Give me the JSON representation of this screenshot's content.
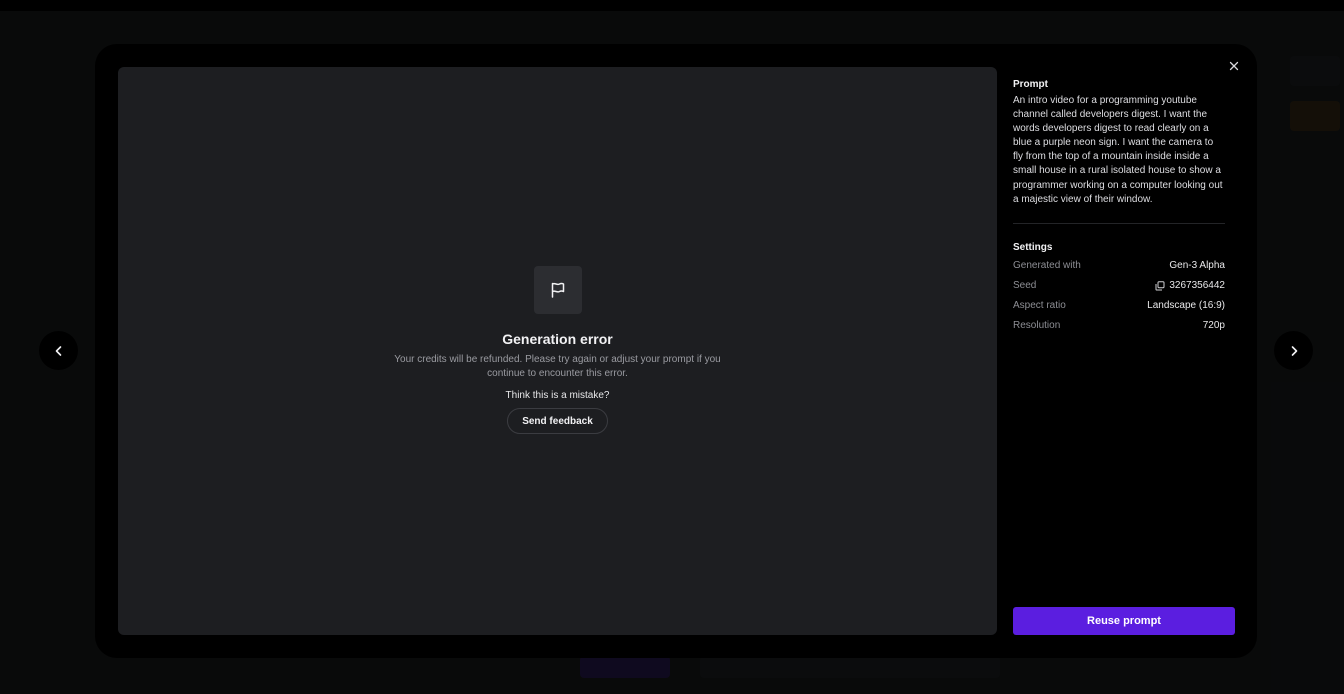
{
  "preview": {
    "flag_icon": "flag-icon",
    "error_title": "Generation error",
    "error_message": "Your credits will be refunded. Please try again or adjust your prompt if you continue to encounter this error.",
    "mistake_text": "Think this is a mistake?",
    "feedback_label": "Send feedback"
  },
  "details": {
    "prompt_title": "Prompt",
    "prompt_text": "An intro video for a programming youtube channel called developers digest. I want the words developers digest to read clearly on a blue a purple neon sign. I want the camera to fly from the top of a mountain inside inside a small house in a rural isolated house to show a programmer working on a computer looking out a majestic view of their window.",
    "settings_title": "Settings",
    "settings": [
      {
        "label": "Generated with",
        "value": "Gen-3 Alpha"
      },
      {
        "label": "Seed",
        "value": "3267356442",
        "icon": "copy-icon"
      },
      {
        "label": "Aspect ratio",
        "value": "Landscape (16:9)"
      },
      {
        "label": "Resolution",
        "value": "720p"
      }
    ],
    "reuse_label": "Reuse prompt"
  },
  "icons": {
    "close": "close-icon",
    "prev": "chevron-left-icon",
    "next": "chevron-right-icon"
  },
  "colors": {
    "accent": "#5b1ee0",
    "modal_bg": "#000000",
    "preview_bg": "#1d1e21"
  }
}
